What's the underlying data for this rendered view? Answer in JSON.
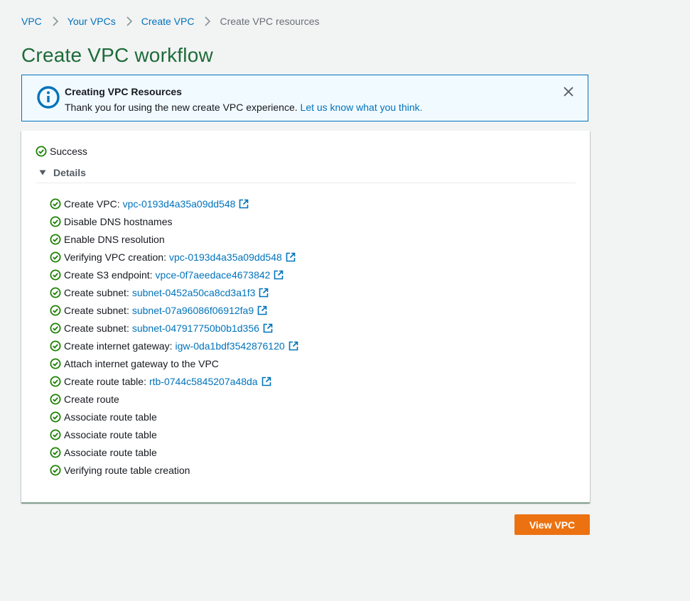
{
  "breadcrumb": {
    "items": [
      "VPC",
      "Your VPCs",
      "Create VPC"
    ],
    "current": "Create VPC resources"
  },
  "page": {
    "title": "Create VPC workflow"
  },
  "flash": {
    "title": "Creating VPC Resources",
    "message": "Thank you for using the new create VPC experience.",
    "link": "Let us know what you think."
  },
  "status": {
    "label": "Success"
  },
  "details": {
    "label": "Details"
  },
  "steps": [
    {
      "label": "Create VPC:",
      "link": "vpc-0193d4a35a09dd548"
    },
    {
      "label": "Disable DNS hostnames"
    },
    {
      "label": "Enable DNS resolution"
    },
    {
      "label": "Verifying VPC creation:",
      "link": "vpc-0193d4a35a09dd548"
    },
    {
      "label": "Create S3 endpoint:",
      "link": "vpce-0f7aeedace4673842"
    },
    {
      "label": "Create subnet:",
      "link": "subnet-0452a50ca8cd3a1f3"
    },
    {
      "label": "Create subnet:",
      "link": "subnet-07a96086f06912fa9"
    },
    {
      "label": "Create subnet:",
      "link": "subnet-047917750b0b1d356"
    },
    {
      "label": "Create internet gateway:",
      "link": "igw-0da1bdf3542876120"
    },
    {
      "label": "Attach internet gateway to the VPC"
    },
    {
      "label": "Create route table:",
      "link": "rtb-0744c5845207a48da"
    },
    {
      "label": "Create route"
    },
    {
      "label": "Associate route table"
    },
    {
      "label": "Associate route table"
    },
    {
      "label": "Associate route table"
    },
    {
      "label": "Verifying route table creation"
    }
  ],
  "actions": {
    "view_vpc": "View VPC"
  },
  "colors": {
    "success": "#1d8102",
    "link": "#0073bb",
    "info": "#0073bb",
    "title": "#1e6b3a",
    "primary_button": "#ec7211"
  },
  "icons": {
    "info": "info-circle-icon",
    "close": "close-icon",
    "success": "check-circle-icon",
    "external": "external-link-icon",
    "caret": "caret-down-icon",
    "separator": "chevron-right-icon"
  }
}
